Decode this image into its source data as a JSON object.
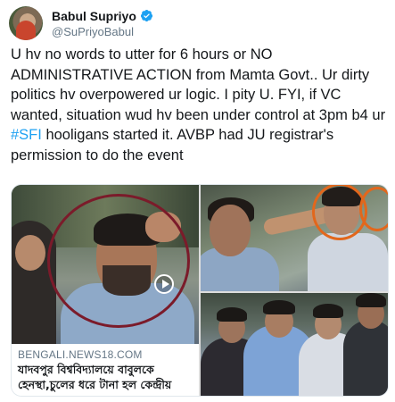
{
  "user": {
    "display_name": "Babul Supriyo",
    "handle": "@SuPriyoBabul",
    "verified": true,
    "verified_color": "#1da1f2",
    "avatar_icon": "profile-avatar"
  },
  "tweet": {
    "text_before": "U hv no words to utter for 6 hours or NO ADMINISTRATIVE ACTION from Mamta Govt.. Ur dirty politics hv overpowered ur logic. I pity U. FYI, if VC wanted, situation wud hv been under control at 3pm b4 ur ",
    "hashtag": "#SFI",
    "text_after": " hooligans started it. AVBP had JU registrar's permission to do the event",
    "hashtag_color": "#1da1f2"
  },
  "media": {
    "card": {
      "domain": "BENGALI.NEWS18.COM",
      "headline_line1": "যাদবপুর বিশ্ববিদ্যালয়ে বাবুলকে",
      "headline_line2": "হেনস্থা,চুলের ধরে টানা হল কেন্দ্রীয়",
      "play_icon": "play-icon"
    },
    "photo_top_right": "photo-crowd-scuffle",
    "photo_bottom_right": "photo-crowd-gathering"
  }
}
